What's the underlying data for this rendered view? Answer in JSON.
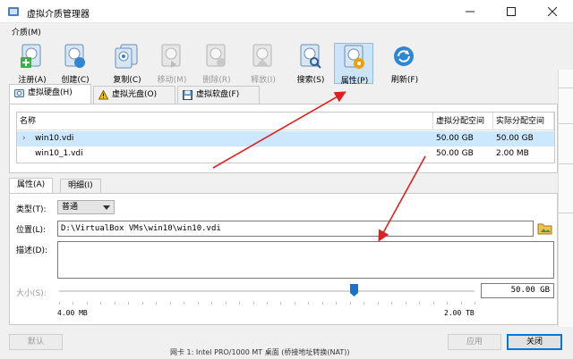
{
  "window": {
    "title": "虚拟介质管理器"
  },
  "menu": {
    "items": [
      {
        "label": "介质(M)"
      }
    ]
  },
  "toolbar": {
    "items": [
      {
        "label": "注册(A)",
        "icon": "register-disk-icon",
        "enabled": true
      },
      {
        "label": "创建(C)",
        "icon": "create-disk-icon",
        "enabled": true
      },
      {
        "label": "复制(C)",
        "icon": "copy-disk-icon",
        "enabled": true
      },
      {
        "label": "移动(M)",
        "icon": "move-disk-icon",
        "enabled": false
      },
      {
        "label": "删除(R)",
        "icon": "remove-disk-icon",
        "enabled": false
      },
      {
        "label": "释放(I)",
        "icon": "release-disk-icon",
        "enabled": false
      },
      {
        "label": "搜索(S)",
        "icon": "search-disk-icon",
        "enabled": true
      },
      {
        "label": "属性(P)",
        "icon": "properties-disk-icon",
        "enabled": true
      },
      {
        "label": "刷新(F)",
        "icon": "refresh-icon",
        "enabled": true
      }
    ]
  },
  "media_tabs": [
    {
      "label": "虚拟硬盘(H)",
      "icon": "hard-disk-icon"
    },
    {
      "label": "虚拟光盘(O)",
      "icon": "optical-disk-warning-icon"
    },
    {
      "label": "虚拟软盘(F)",
      "icon": "floppy-disk-icon"
    }
  ],
  "table": {
    "columns": [
      "名称",
      "虚拟分配空间",
      "实际分配空间"
    ],
    "rows": [
      {
        "name": "win10.vdi",
        "virtual": "50.00 GB",
        "actual": "50.00 GB"
      },
      {
        "name": "win10_1.vdi",
        "virtual": "50.00 GB",
        "actual": "2.00 MB"
      }
    ]
  },
  "detail_tabs": [
    {
      "label": "属性(A)"
    },
    {
      "label": "明细(I)"
    }
  ],
  "properties": {
    "type_label": "类型(T):",
    "type_value": "普通",
    "location_label": "位置(L):",
    "location_value": "D:\\VirtualBox VMs\\win10\\win10.vdi",
    "description_label": "描述(D):",
    "size_label": "大小(S):",
    "size_value": "50.00 GB",
    "size_min": "4.00 MB",
    "size_max": "2.00 TB",
    "size_fraction": 0.71
  },
  "buttons": {
    "reset": "默认",
    "apply": "应用",
    "close": "关闭"
  },
  "background_text": "网卡 1:  Intel PRO/1000 MT 桌面 (桥接地址转换(NAT))"
}
